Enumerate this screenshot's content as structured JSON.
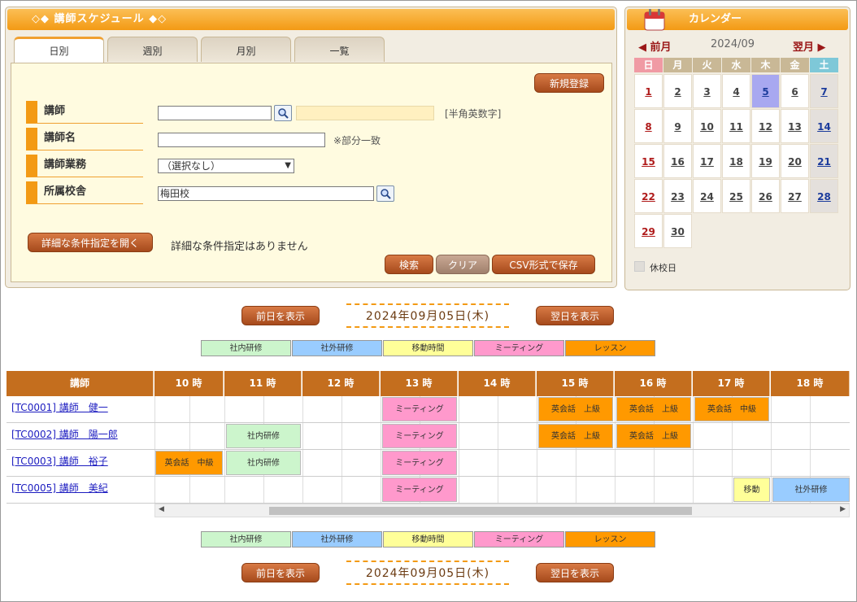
{
  "panel": {
    "title": "◇◆ 講師スケジュール ◆◇",
    "tabs": [
      "日別",
      "週別",
      "月別",
      "一覧"
    ],
    "new_button": "新規登録",
    "labels": {
      "instructor": "講師",
      "instructor_name": "講師名",
      "duty": "講師業務",
      "school": "所属校舎"
    },
    "hint_alnum": "[半角英数字]",
    "hint_partial": "※部分一致",
    "duty_select": "（選択なし）",
    "school_value": "梅田校",
    "detail_button": "詳細な条件指定を開く",
    "detail_text": "詳細な条件指定はありません",
    "search_button": "検索",
    "clear_button": "クリア",
    "csv_button": "CSV形式で保存"
  },
  "calendar": {
    "title": "カレンダー",
    "prev": "◀ 前月",
    "year_month": "2024/09",
    "next": "翌月 ▶",
    "weekdays": [
      "日",
      "月",
      "火",
      "水",
      "木",
      "金",
      "土"
    ],
    "weeks": [
      [
        "1",
        "2",
        "3",
        "4",
        "5",
        "6",
        "7"
      ],
      [
        "8",
        "9",
        "10",
        "11",
        "12",
        "13",
        "14"
      ],
      [
        "15",
        "16",
        "17",
        "18",
        "19",
        "20",
        "21"
      ],
      [
        "22",
        "23",
        "24",
        "25",
        "26",
        "27",
        "28"
      ],
      [
        "29",
        "30",
        "",
        "",
        "",
        "",
        ""
      ]
    ],
    "today": "5",
    "holiday_legend": "休校日"
  },
  "nav": {
    "prev_day": "前日を表示",
    "next_day": "翌日を表示",
    "date": "2024年09月05日(木)"
  },
  "legend": [
    {
      "label": "社内研修",
      "color": "#ccf5cc"
    },
    {
      "label": "社外研修",
      "color": "#99ccff"
    },
    {
      "label": "移動時間",
      "color": "#ffff99"
    },
    {
      "label": "ミーティング",
      "color": "#ff99cc"
    },
    {
      "label": "レッスン",
      "color": "#ff9900"
    }
  ],
  "schedule": {
    "header": [
      "講師",
      "10 時",
      "11 時",
      "12 時",
      "13 時",
      "14 時",
      "15 時",
      "16 時",
      "17 時",
      "18 時"
    ],
    "rows": [
      {
        "name": "[TC0001] 講師　健一",
        "events": [
          {
            "label": "ミーティング",
            "type": "meeting"
          },
          {
            "label": "英会話　上級",
            "type": "lesson"
          },
          {
            "label": "英会話　上級",
            "type": "lesson"
          },
          {
            "label": "英会話　中級",
            "type": "lesson"
          }
        ]
      },
      {
        "name": "[TC0002] 講師　陽一郎",
        "events": [
          {
            "label": "社内研修",
            "type": "internal"
          },
          {
            "label": "ミーティング",
            "type": "meeting"
          },
          {
            "label": "英会話　上級",
            "type": "lesson"
          },
          {
            "label": "英会話　上級",
            "type": "lesson"
          }
        ]
      },
      {
        "name": "[TC0003] 講師　裕子",
        "events": [
          {
            "label": "英会話　中級",
            "type": "lesson"
          },
          {
            "label": "社内研修",
            "type": "internal"
          },
          {
            "label": "ミーティング",
            "type": "meeting"
          }
        ]
      },
      {
        "name": "[TC0005] 講師　美紀",
        "events": [
          {
            "label": "ミーティング",
            "type": "meeting"
          },
          {
            "label": "移動",
            "type": "move"
          },
          {
            "label": "社外研修",
            "type": "external"
          }
        ]
      }
    ]
  }
}
